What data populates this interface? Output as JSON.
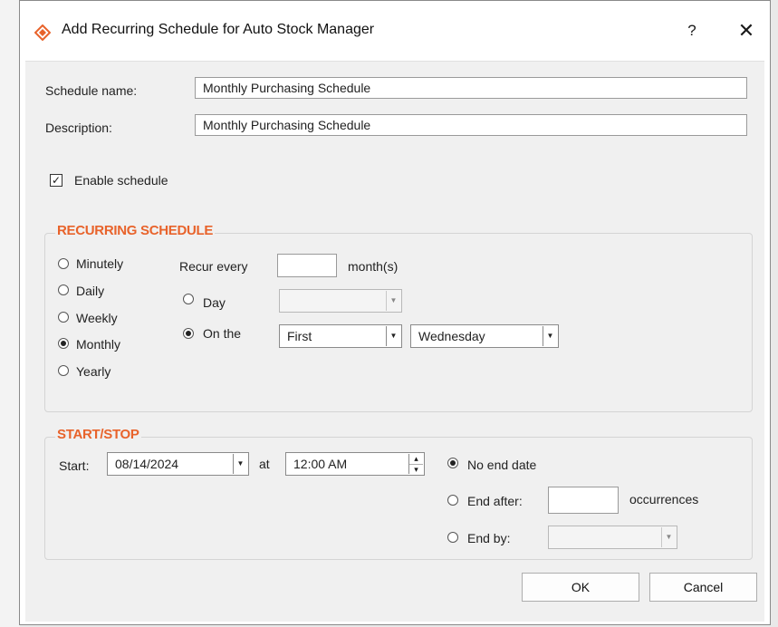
{
  "window": {
    "title": "Add Recurring Schedule for Auto Stock Manager",
    "help_label": "?",
    "close_label": "✕"
  },
  "form": {
    "schedule_name_label": "Schedule name:",
    "schedule_name_value": "Monthly Purchasing Schedule",
    "description_label": "Description:",
    "description_value": "Monthly Purchasing Schedule",
    "enable_label": "Enable schedule",
    "enable_checked": true
  },
  "recurring": {
    "title": "RECURRING SCHEDULE",
    "frequency_options": [
      {
        "label": "Minutely",
        "selected": false
      },
      {
        "label": "Daily",
        "selected": false
      },
      {
        "label": "Weekly",
        "selected": false
      },
      {
        "label": "Monthly",
        "selected": true
      },
      {
        "label": "Yearly",
        "selected": false
      }
    ],
    "recur_every_label": "Recur every",
    "recur_every_value": "",
    "recur_unit": "month(s)",
    "day_label": "Day",
    "day_value": "",
    "on_the_label": "On the",
    "on_the_ordinal": "First",
    "on_the_weekday": "Wednesday",
    "selected_mode": "on_the"
  },
  "startstop": {
    "title": "START/STOP",
    "start_label": "Start:",
    "start_date": "08/14/2024",
    "at_label": "at",
    "start_time": "12:00 AM",
    "no_end_label": "No end date",
    "end_after_label": "End after:",
    "end_after_value": "",
    "occurrences_label": "occurrences",
    "end_by_label": "End by:",
    "end_by_value": "",
    "selected_end": "no_end"
  },
  "buttons": {
    "ok": "OK",
    "cancel": "Cancel"
  },
  "colors": {
    "accent": "#e8632b"
  }
}
